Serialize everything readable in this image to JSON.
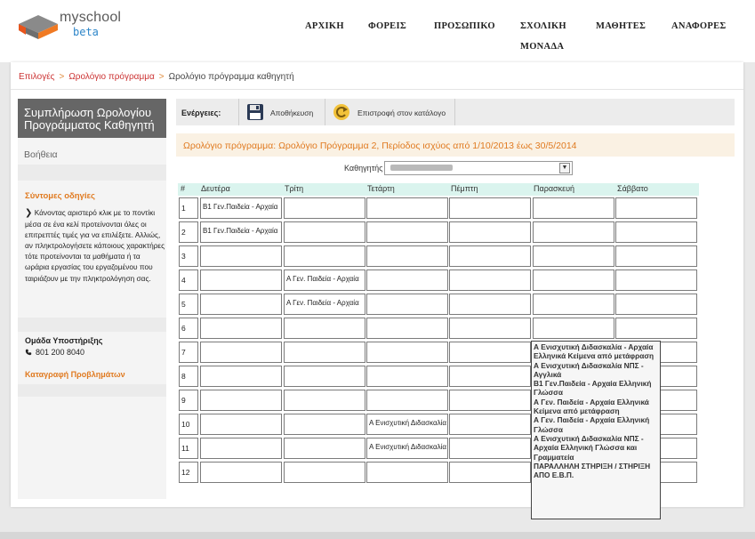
{
  "app": {
    "name": "myschool",
    "badge": "beta"
  },
  "nav": {
    "items": [
      {
        "label": "ΑΡΧΙΚΗ"
      },
      {
        "label": "ΦΟΡΕΙΣ"
      },
      {
        "label": "ΠΡΟΣΩΠΙΚΟ"
      },
      {
        "label": "ΣΧΟΛΙΚΗ",
        "label2": "ΜΟΝΑΔΑ"
      },
      {
        "label": "ΜΑΘΗΤΕΣ"
      },
      {
        "label": "ΑΝΑΦΟΡΕΣ"
      }
    ]
  },
  "breadcrumb": {
    "items": [
      "Επιλογές",
      "Ωρολόγιο πρόγραμμα",
      "Ωρολόγιο πρόγραμμα καθηγητή"
    ],
    "separator": ">"
  },
  "sidebar": {
    "title": "Συμπλήρωση Ωρολογίου Προγράμματος Καθηγητή",
    "help": "Βοήθεια",
    "tips_title": "Σύντομες οδηγίες",
    "tips_arrow": "❯",
    "tips_text": "Κάνοντας αριστερό κλικ με το ποντίκι μέσα σε ένα κελί προτείνονται όλες οι επιτρεπτές τιμές για να επιλέξετε. Αλλιώς, αν πληκτρολογήσετε κάποιους χαρακτήρες τότε προτείνονται τα μαθήματα ή τα ωράρια εργασίας του εργαζομένου που ταιριάζουν με την πληκτρολόγηση σας.",
    "support_title": "Ομάδα Υποστήριξης",
    "support_phone": "801 200 8040",
    "report_link": "Καταγραφή Προβλημάτων"
  },
  "toolbar": {
    "label": "Ενέργειες:",
    "save_label": "Αποθήκευση",
    "back_label": "Επιστροφή στον κατάλογο"
  },
  "info": {
    "text": "Ωρολόγιο πρόγραμμα: Ωρολόγιο Πρόγραμμα 2, Περίοδος ισχύος από 1/10/2013 έως 30/5/2014"
  },
  "teacher": {
    "label": "Καθηγητής"
  },
  "grid": {
    "headers": [
      "#",
      "Δευτέρα",
      "Τρίτη",
      "Τετάρτη",
      "Πέμπτη",
      "Παρασκευή",
      "Σάββατο"
    ],
    "rows": [
      {
        "n": "1",
        "cells": [
          "Β1 Γεν.Παιδεία - Αρχαία",
          "",
          "",
          "",
          "",
          ""
        ]
      },
      {
        "n": "2",
        "cells": [
          "Β1 Γεν.Παιδεία - Αρχαία",
          "",
          "",
          "",
          "",
          ""
        ]
      },
      {
        "n": "3",
        "cells": [
          "",
          "",
          "",
          "",
          "",
          ""
        ]
      },
      {
        "n": "4",
        "cells": [
          "",
          "Α Γεν. Παιδεία - Αρχαία",
          "",
          "",
          "",
          ""
        ]
      },
      {
        "n": "5",
        "cells": [
          "",
          "Α Γεν. Παιδεία - Αρχαία",
          "",
          "",
          "",
          ""
        ]
      },
      {
        "n": "6",
        "cells": [
          "",
          "",
          "",
          "",
          "",
          ""
        ]
      },
      {
        "n": "7",
        "cells": [
          "",
          "",
          "",
          "",
          "",
          ""
        ]
      },
      {
        "n": "8",
        "cells": [
          "",
          "",
          "",
          "",
          "",
          ""
        ]
      },
      {
        "n": "9",
        "cells": [
          "",
          "",
          "",
          "",
          "",
          ""
        ]
      },
      {
        "n": "10",
        "cells": [
          "",
          "",
          "Α Ενισχυτική Διδασκαλία",
          "",
          "",
          ""
        ]
      },
      {
        "n": "11",
        "cells": [
          "",
          "",
          "Α Ενισχυτική Διδασκαλία",
          "",
          "",
          ""
        ]
      },
      {
        "n": "12",
        "cells": [
          "",
          "",
          "",
          "",
          "",
          ""
        ]
      }
    ]
  },
  "suggestions": [
    "Α Ενισχυτική Διδασκαλία - Αρχαία Ελληνικά Κείμενα από μετάφραση",
    "Α Ενισχυτική Διδασκαλία ΝΠΣ - Αγγλικά",
    "Β1 Γεν.Παιδεία - Αρχαία Ελληνική Γλώσσα",
    "Α Γεν. Παιδεία - Αρχαία Ελληνικά Κείμενα από μετάφραση",
    "Α Γεν. Παιδεία - Αρχαία Ελληνική Γλώσσα",
    "Α Ενισχυτική Διδασκαλία ΝΠΣ - Αρχαία Ελληνική Γλώσσα και Γραμματεία",
    "ΠΑΡΑΛΛΗΛΗ ΣΤΗΡΙΞΗ / ΣΤΗΡΙΞΗ ΑΠΟ Ε.Β.Π."
  ],
  "colors": {
    "accent": "#e07a20",
    "link": "#cc3333",
    "header_bg": "#666666",
    "grid_head": "#daf4ee",
    "beta": "#2d86c9"
  },
  "icons": {
    "save": "floppy-disk-icon",
    "back": "return-arrow-icon",
    "phone": "phone-icon",
    "logo": "myschool-logo-icon"
  }
}
